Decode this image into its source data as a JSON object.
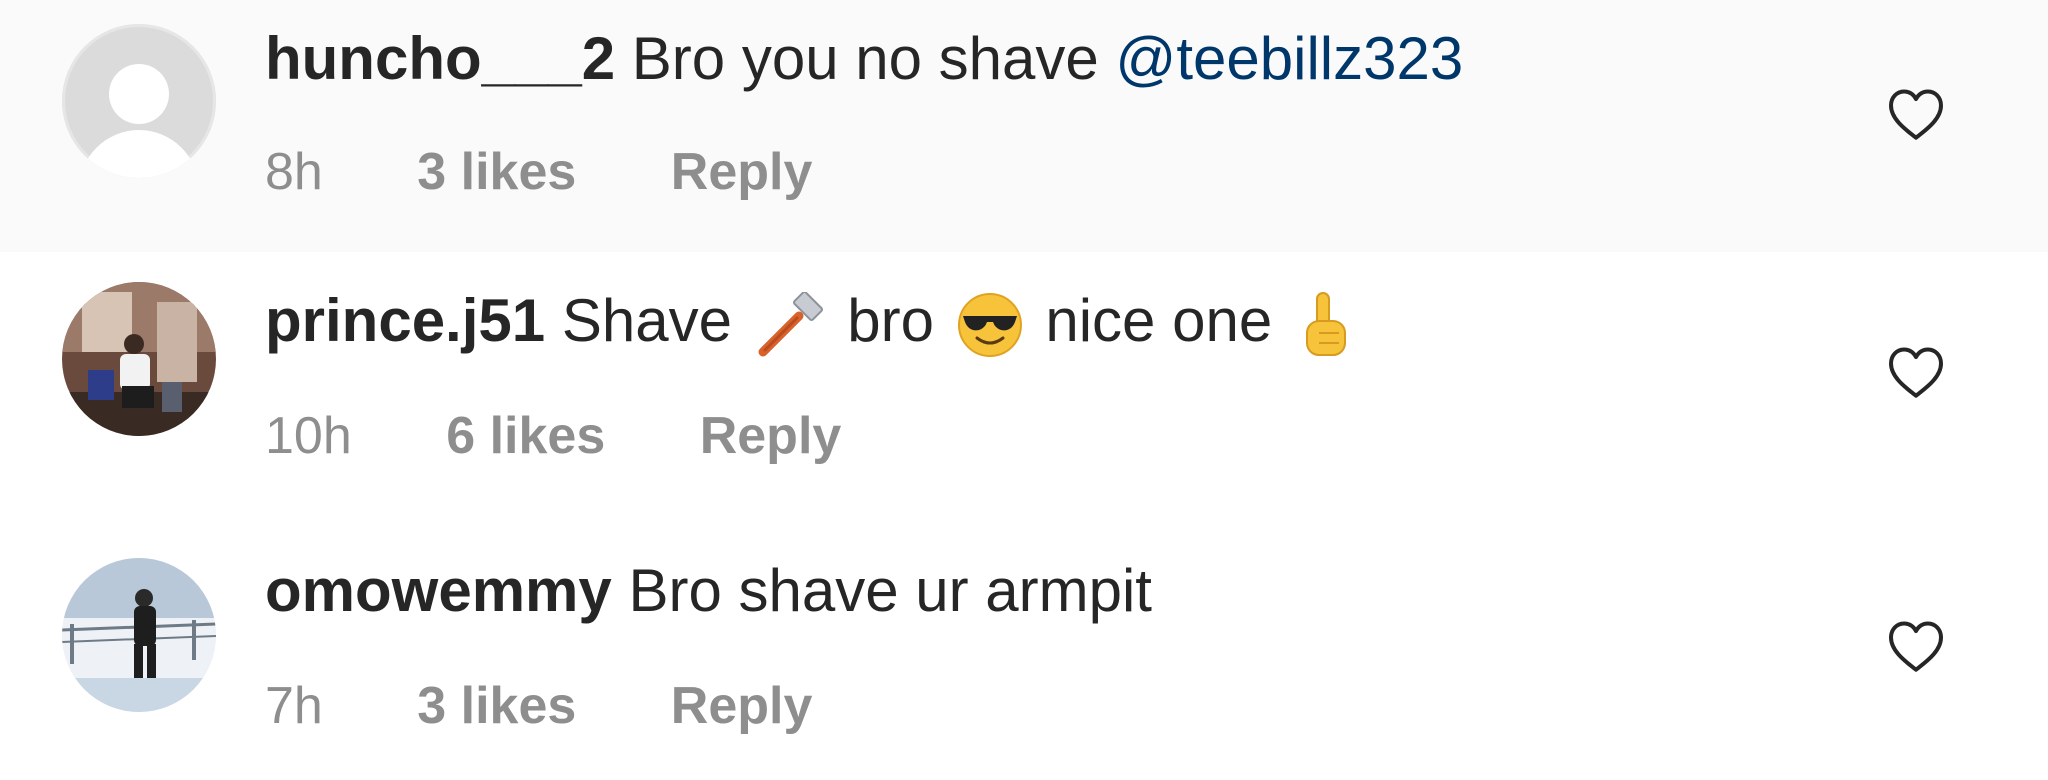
{
  "comments": [
    {
      "username": "huncho___2",
      "text": "Bro you no shave",
      "mention": "@teebillz323",
      "time": "8h",
      "likes": "3 likes",
      "reply": "Reply",
      "avatar": "default-avatar-icon"
    },
    {
      "username": "prince.j51",
      "text_parts": [
        "Shave",
        "bro",
        "nice one"
      ],
      "emojis": [
        "razor-emoji",
        "sunglasses-face-emoji",
        "pointing-up-hand-emoji"
      ],
      "time": "10h",
      "likes": "6 likes",
      "reply": "Reply",
      "avatar": "photo-avatar"
    },
    {
      "username": "omowemmy",
      "text": "Bro shave ur armpit",
      "time": "7h",
      "likes": "3 likes",
      "reply": "Reply",
      "avatar": "photo-avatar"
    }
  ],
  "icons": {
    "like": "heart-outline-icon"
  },
  "colors": {
    "text": "#262626",
    "secondary": "#8e8e8e",
    "mention": "#00376b",
    "highlight_row": "#fafafa"
  }
}
